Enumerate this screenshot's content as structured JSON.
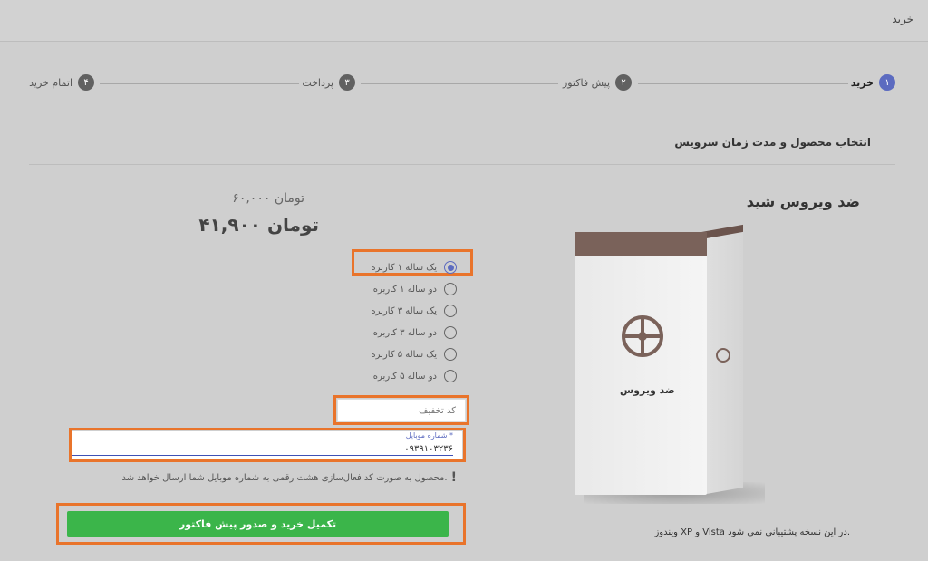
{
  "header": {
    "title": "خرید"
  },
  "steps": [
    {
      "num": "۱",
      "label": "خرید"
    },
    {
      "num": "۲",
      "label": "پیش فاکتور"
    },
    {
      "num": "۳",
      "label": "پرداخت"
    },
    {
      "num": "۴",
      "label": "اتمام خرید"
    }
  ],
  "section_title": "انتخاب محصول و مدت زمان سرویس",
  "product": {
    "name": "ضد ویروس شید",
    "box_label": "ضد ویروس",
    "support_note": "ویندوز XP و Vista در این نسخه پشتیبانی نمی شود."
  },
  "price": {
    "old": "۶۰,۰۰۰ تومان",
    "new": "۴۱,۹۰۰ تومان"
  },
  "options": [
    {
      "label": "یک ساله ۱ کاربره",
      "selected": true
    },
    {
      "label": "دو ساله ۱ کاربره"
    },
    {
      "label": "یک ساله  ۳ کاربره"
    },
    {
      "label": "دو ساله ۳ کاربره"
    },
    {
      "label": "یک ساله ۵ کاربره"
    },
    {
      "label": "دو ساله ۵ کاربره"
    }
  ],
  "discount": {
    "placeholder": "کد تخفیف"
  },
  "mobile": {
    "label": "شماره موبایل *",
    "value": "۰۹۳۹۱۰۳۲۳۶"
  },
  "notice": "محصول به صورت کد فعال‌سازی هشت رقمی به شماره موبایل شما ارسال خواهد شد.",
  "submit_label": "تکمیل خرید و صدور پیش فاکتور",
  "colors": {
    "accent": "#5c6bc0",
    "submit": "#3bb54a",
    "highlight": "#e9742b",
    "brand_brown": "#7a625a"
  }
}
